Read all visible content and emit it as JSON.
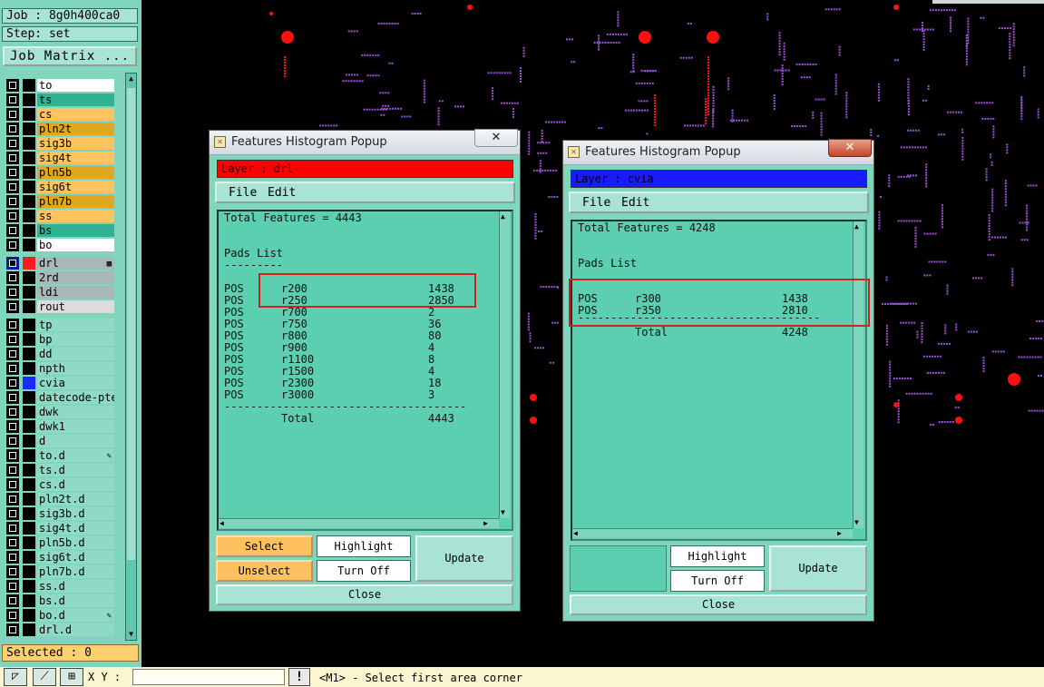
{
  "left_panel": {
    "job_label": "Job : 8g0h400ca0",
    "step_label": "Step: set",
    "job_matrix_button": "Job Matrix ...",
    "selected_label": "Selected : 0",
    "layers": [
      {
        "name": "to",
        "bg": "#ffffff",
        "swatch": "#000000"
      },
      {
        "name": "ts",
        "bg": "#2fb393",
        "swatch": "#000000"
      },
      {
        "name": "cs",
        "bg": "#ffc460",
        "swatch": "#000000"
      },
      {
        "name": "pln2t",
        "bg": "#e0a820",
        "swatch": "#000000"
      },
      {
        "name": "sig3b",
        "bg": "#ffc460",
        "swatch": "#000000"
      },
      {
        "name": "sig4t",
        "bg": "#ffc460",
        "swatch": "#000000"
      },
      {
        "name": "pln5b",
        "bg": "#e0a820",
        "swatch": "#000000"
      },
      {
        "name": "sig6t",
        "bg": "#ffc460",
        "swatch": "#000000"
      },
      {
        "name": "pln7b",
        "bg": "#e0a820",
        "swatch": "#000000"
      },
      {
        "name": "ss",
        "bg": "#ffc460",
        "swatch": "#000000"
      },
      {
        "name": "bs",
        "bg": "#2fb393",
        "swatch": "#000000"
      },
      {
        "name": "bo",
        "bg": "#ffffff",
        "swatch": "#000000"
      },
      {
        "gap": true
      },
      {
        "name": "drl",
        "bg": "#a6b8b8",
        "swatch": "#ff1a1a",
        "cb": "#0a1aa0",
        "mark": "▩"
      },
      {
        "name": "2rd",
        "bg": "#a6b8b8",
        "swatch": "#000000"
      },
      {
        "name": "ldi",
        "bg": "#a6b8b8",
        "swatch": "#000000"
      },
      {
        "name": "rout",
        "bg": "#dcdcdc",
        "swatch": "#000000"
      },
      {
        "gap": true
      },
      {
        "name": "tp",
        "bg": "#8fd9c5",
        "swatch": "#000000"
      },
      {
        "name": "bp",
        "bg": "#8fd9c5",
        "swatch": "#000000"
      },
      {
        "name": "dd",
        "bg": "#8fd9c5",
        "swatch": "#000000"
      },
      {
        "name": "npth",
        "bg": "#8fd9c5",
        "swatch": "#000000"
      },
      {
        "name": "cvia",
        "bg": "#8fd9c5",
        "swatch": "#1a2cff"
      },
      {
        "name": "datecode-pte",
        "bg": "#8fd9c5",
        "swatch": "#000000"
      },
      {
        "name": "dwk",
        "bg": "#8fd9c5",
        "swatch": "#000000"
      },
      {
        "name": "dwk1",
        "bg": "#8fd9c5",
        "swatch": "#000000"
      },
      {
        "name": "d",
        "bg": "#8fd9c5",
        "swatch": "#000000"
      },
      {
        "name": "to.d",
        "bg": "#8fd9c5",
        "swatch": "#000000",
        "mark": "✎"
      },
      {
        "name": "ts.d",
        "bg": "#8fd9c5",
        "swatch": "#000000"
      },
      {
        "name": "cs.d",
        "bg": "#8fd9c5",
        "swatch": "#000000"
      },
      {
        "name": "pln2t.d",
        "bg": "#8fd9c5",
        "swatch": "#000000"
      },
      {
        "name": "sig3b.d",
        "bg": "#8fd9c5",
        "swatch": "#000000"
      },
      {
        "name": "sig4t.d",
        "bg": "#8fd9c5",
        "swatch": "#000000"
      },
      {
        "name": "pln5b.d",
        "bg": "#8fd9c5",
        "swatch": "#000000"
      },
      {
        "name": "sig6t.d",
        "bg": "#8fd9c5",
        "swatch": "#000000"
      },
      {
        "name": "pln7b.d",
        "bg": "#8fd9c5",
        "swatch": "#000000"
      },
      {
        "name": "ss.d",
        "bg": "#8fd9c5",
        "swatch": "#000000"
      },
      {
        "name": "bs.d",
        "bg": "#8fd9c5",
        "swatch": "#000000"
      },
      {
        "name": "bo.d",
        "bg": "#8fd9c5",
        "swatch": "#000000",
        "mark": "✎"
      },
      {
        "name": "drl.d",
        "bg": "#8fd9c5",
        "swatch": "#000000"
      }
    ]
  },
  "status_bar": {
    "xy_label": "X Y :",
    "xy_value": "",
    "alert_icon": "!",
    "message": "<M1> - Select first area corner"
  },
  "popup_drl": {
    "title": "Features Histogram Popup",
    "close_glyph": "✕",
    "layer_text": "Layer :  drl",
    "layer_color": "#ff0000",
    "menu": {
      "file": "File",
      "edit": "Edit"
    },
    "total_line": "Total Features = 4443",
    "pads_heading": "Pads List",
    "pads_underline": "---------",
    "rows": [
      [
        "POS",
        "r200",
        "1438"
      ],
      [
        "POS",
        "r250",
        "2850"
      ],
      [
        "POS",
        "r700",
        "2"
      ],
      [
        "POS",
        "r750",
        "36"
      ],
      [
        "POS",
        "r800",
        "80"
      ],
      [
        "POS",
        "r900",
        "4"
      ],
      [
        "POS",
        "r1100",
        "8"
      ],
      [
        "POS",
        "r1500",
        "4"
      ],
      [
        "POS",
        "r2300",
        "18"
      ],
      [
        "POS",
        "r3000",
        "3"
      ]
    ],
    "separator": "------------------------------------------",
    "total_label": "Total",
    "total_value": "4443",
    "buttons": {
      "select": "Select",
      "unselect": "Unselect",
      "highlight": "Highlight",
      "turn_off": "Turn Off",
      "update": "Update",
      "close": "Close"
    }
  },
  "popup_cvia": {
    "title": "Features Histogram Popup",
    "close_glyph": "✕",
    "layer_text": "Layer :  cvia",
    "layer_color": "#1a1aff",
    "menu": {
      "file": "File",
      "edit": "Edit"
    },
    "total_line": "Total Features = 4248",
    "pads_heading": "Pads List",
    "rows": [
      [
        "POS",
        "r300",
        "1438"
      ],
      [
        "POS",
        "r350",
        "2810"
      ]
    ],
    "separator": "------------------------------------------",
    "total_label": "Total",
    "total_value": "4248",
    "buttons": {
      "highlight": "Highlight",
      "turn_off": "Turn Off",
      "update": "Update",
      "close": "Close"
    }
  },
  "colors": {
    "panel": "#7fd6bd",
    "list_bg": "#5ccfb1",
    "canvas_bg": "#000000",
    "trace_dots": "#a050d8",
    "pad_red": "#ff1010",
    "highlight_box": "#d62020"
  }
}
